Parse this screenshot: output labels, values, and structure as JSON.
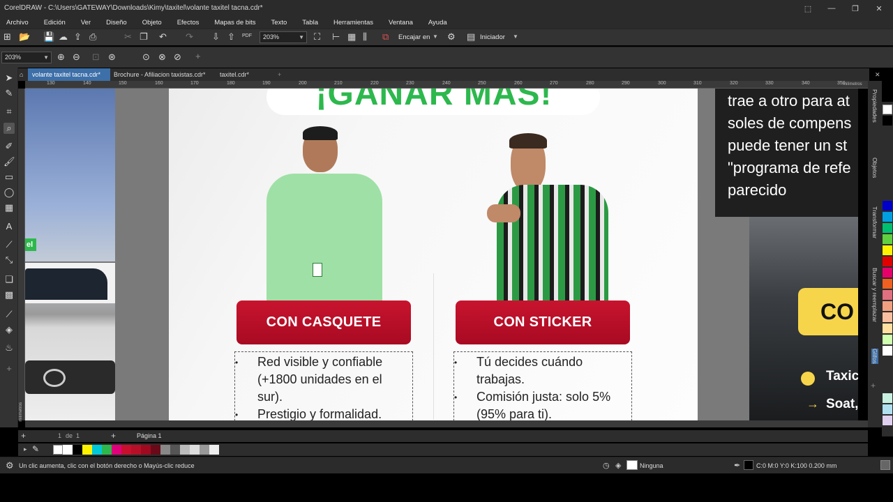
{
  "window": {
    "title": "CorelDRAW - C:\\Users\\GATEWAY\\Downloads\\Kimy\\taxitel\\volante taxitel tacna.cdr*"
  },
  "menu": [
    "Archivo",
    "Edición",
    "Ver",
    "Diseño",
    "Objeto",
    "Efectos",
    "Mapas de bits",
    "Texto",
    "Tabla",
    "Herramientas",
    "Ventana",
    "Ayuda"
  ],
  "toolbar": {
    "zoom_value": "203%",
    "fit_label": "Encajar en",
    "launcher_label": "Iniciador",
    "pdf_label": "PDF",
    "zoom_value_2": "203%"
  },
  "tabs": [
    {
      "label": "volante taxitel tacna.cdr*",
      "active": true
    },
    {
      "label": "Brochure - Afiliacion taxistas.cdr*",
      "active": false
    },
    {
      "label": "taxitel.cdr*",
      "active": false
    }
  ],
  "ruler": {
    "ticks": [
      "130",
      "140",
      "150",
      "160",
      "170",
      "180",
      "190",
      "200",
      "210",
      "220",
      "230",
      "240",
      "250",
      "260",
      "270",
      "280",
      "290",
      "300",
      "310",
      "320",
      "330",
      "340",
      "350"
    ],
    "units": "milímetros",
    "v_units": "milímetros"
  },
  "flyer": {
    "headline": "¡GANAR MÁS!",
    "left_button": "CON CASQUETE",
    "right_button": "CON STICKER",
    "left_bullets": [
      "Red visible y confiable",
      "(+1800 unidades en el",
      "sur).",
      "Prestigio y formalidad."
    ],
    "right_bullets": [
      "Tú decides cuándo",
      "trabajas.",
      "Comisión justa: solo 5%",
      "(95% para ti)."
    ],
    "badge_text": "el"
  },
  "right_panel": {
    "lines": [
      "trae a otro para at",
      "soles de compens",
      "puede tener un st",
      "\"programa de refe",
      "parecido"
    ],
    "banner_text": "CO",
    "item1": "Taxic",
    "item2": "Soat,"
  },
  "dockers": [
    "Propiedades",
    "Objetos",
    "Transformar",
    "Buscar y reemplazar",
    "Glifos"
  ],
  "pagebar": {
    "page_num": "1",
    "of_label": "de",
    "total": "1",
    "page_tab": "Página 1"
  },
  "status": {
    "hint": "Un clic aumenta, clic con el botón derecho o Mayús-clic reduce",
    "fill_label": "Ninguna",
    "color_info": "C:0 M:0 Y:0 K:100  0.200 mm"
  },
  "colors": {
    "accent": "#3d6fa8",
    "button_red": "#b80f28",
    "green": "#2db84d"
  }
}
